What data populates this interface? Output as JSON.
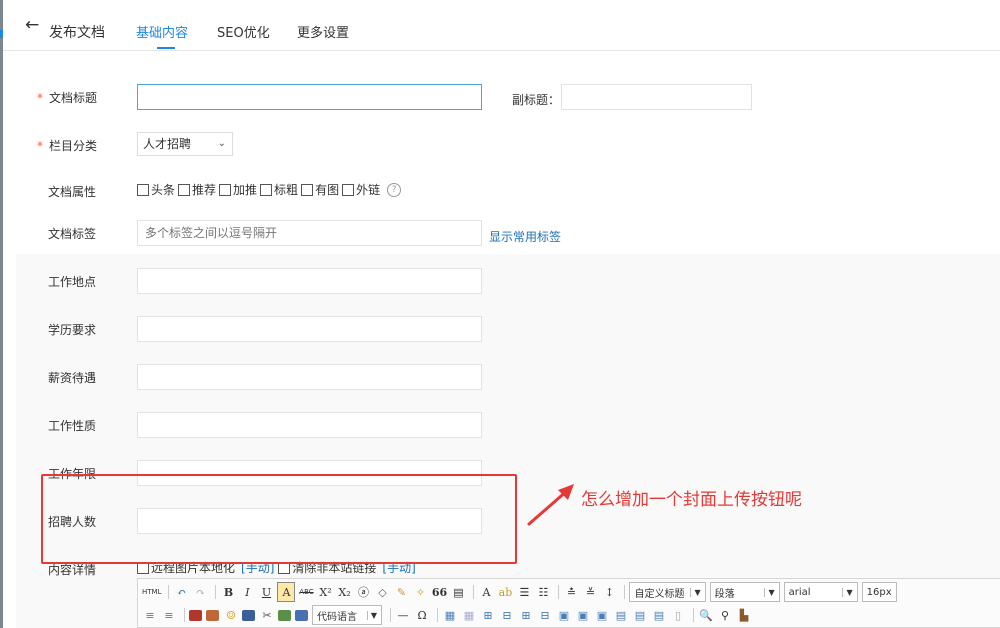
{
  "header": {
    "back_icon": "←",
    "title": "发布文档",
    "tabs": [
      "基础内容",
      "SEO优化",
      "更多设置"
    ]
  },
  "form": {
    "required_mark": "*",
    "doc_title_label": "文档标题",
    "subtitle_label": "副标题：",
    "category_label": "栏目分类",
    "category_value": "人才招聘",
    "attr_label": "文档属性",
    "attrs": [
      "头条",
      "推荐",
      "加推",
      "标粗",
      "有图",
      "外链"
    ],
    "help_icon": "?",
    "tags_label": "文档标签",
    "tags_placeholder": "多个标签之间以逗号隔开",
    "show_tags_link": "显示常用标签",
    "work_location_label": "工作地点",
    "education_label": "学历要求",
    "salary_label": "薪资待遇",
    "job_nature_label": "工作性质",
    "work_years_label": "工作年限",
    "recruit_count_label": "招聘人数",
    "content_label": "内容详情",
    "remote_image_label": "远程图片本地化",
    "manual_label": "[手动]",
    "clear_links_label": "清除非本站链接",
    "manual_label2": "[手动]"
  },
  "annotation": {
    "text": "怎么增加一个封面上传按钮呢",
    "color": "#e53935"
  },
  "editor_toolbar": {
    "row1": {
      "html_btn": "HTML",
      "bold": "B",
      "italic": "I",
      "underline": "U",
      "fontborder": "A",
      "strike": "ABC",
      "sup": "X²",
      "sub": "X₂",
      "quote": "66",
      "forecolor": "A",
      "custom_title": "自定义标题",
      "paragraph": "段落",
      "font": "arial",
      "fontsize": "16px"
    },
    "row2": {
      "code_language": "代码语言",
      "horizontal": "—",
      "omega": "Ω"
    }
  }
}
